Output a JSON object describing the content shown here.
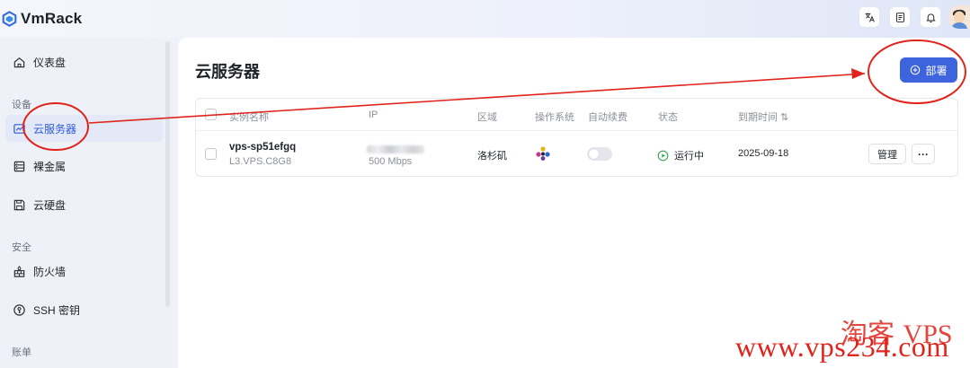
{
  "app": {
    "name": "VmRack"
  },
  "sidebar": {
    "items": [
      {
        "label": "仪表盘",
        "icon": "home-icon"
      },
      {
        "label": "云服务器",
        "icon": "cloud-server-icon",
        "active": true
      },
      {
        "label": "裸金属",
        "icon": "server-rack-icon"
      },
      {
        "label": "云硬盘",
        "icon": "disk-icon"
      },
      {
        "label": "防火墙",
        "icon": "firewall-icon"
      },
      {
        "label": "SSH 密钥",
        "icon": "key-icon"
      }
    ],
    "sections": {
      "devices": "设备",
      "security": "安全",
      "billing": "账单"
    }
  },
  "main": {
    "title": "云服务器",
    "deploy_label": "部署",
    "table": {
      "columns": {
        "name": "实例名称",
        "ip": "IP",
        "region": "区域",
        "os": "操作系统",
        "auto_renew": "自动续费",
        "status": "状态",
        "expiry": "到期时间 ⇅"
      },
      "rows": [
        {
          "name": "vps-sp51efgq",
          "plan": "L3.VPS.C8G8",
          "bandwidth": "500 Mbps",
          "region": "洛杉矶",
          "os_icon": "os-logo-icon",
          "auto_renew": false,
          "status": "运行中",
          "expiry": "2025-09-18",
          "manage_label": "管理",
          "more_label": "···"
        }
      ]
    }
  },
  "watermark": {
    "cn": "淘客",
    "url": "www.vps234.com",
    "suffix": "VPS"
  },
  "colors": {
    "accent": "#3d63dd",
    "annotation": "#e0241b",
    "status_running": "#3aa655"
  }
}
